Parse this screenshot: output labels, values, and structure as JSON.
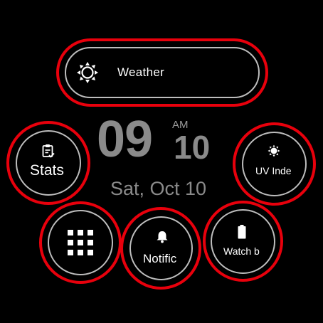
{
  "weather": {
    "label": "Weather",
    "icon": "sun-icon"
  },
  "clock": {
    "hour": "09",
    "ampm": "AM",
    "minute": "10",
    "date": "Sat, Oct 10"
  },
  "complications": {
    "stats": {
      "label": "Stats",
      "icon": "clipboard-check-icon"
    },
    "uv": {
      "label": "UV Inde",
      "icon": "sun-icon"
    },
    "apps": {
      "icon": "app-grid-icon"
    },
    "notifications": {
      "label": "Notific",
      "icon": "bell-icon"
    },
    "battery": {
      "label": "Watch b",
      "icon": "battery-icon"
    }
  },
  "colors": {
    "highlight": "#e8000c",
    "ring": "#bdbdbd",
    "time": "#8a8a8a",
    "background": "#000000"
  }
}
